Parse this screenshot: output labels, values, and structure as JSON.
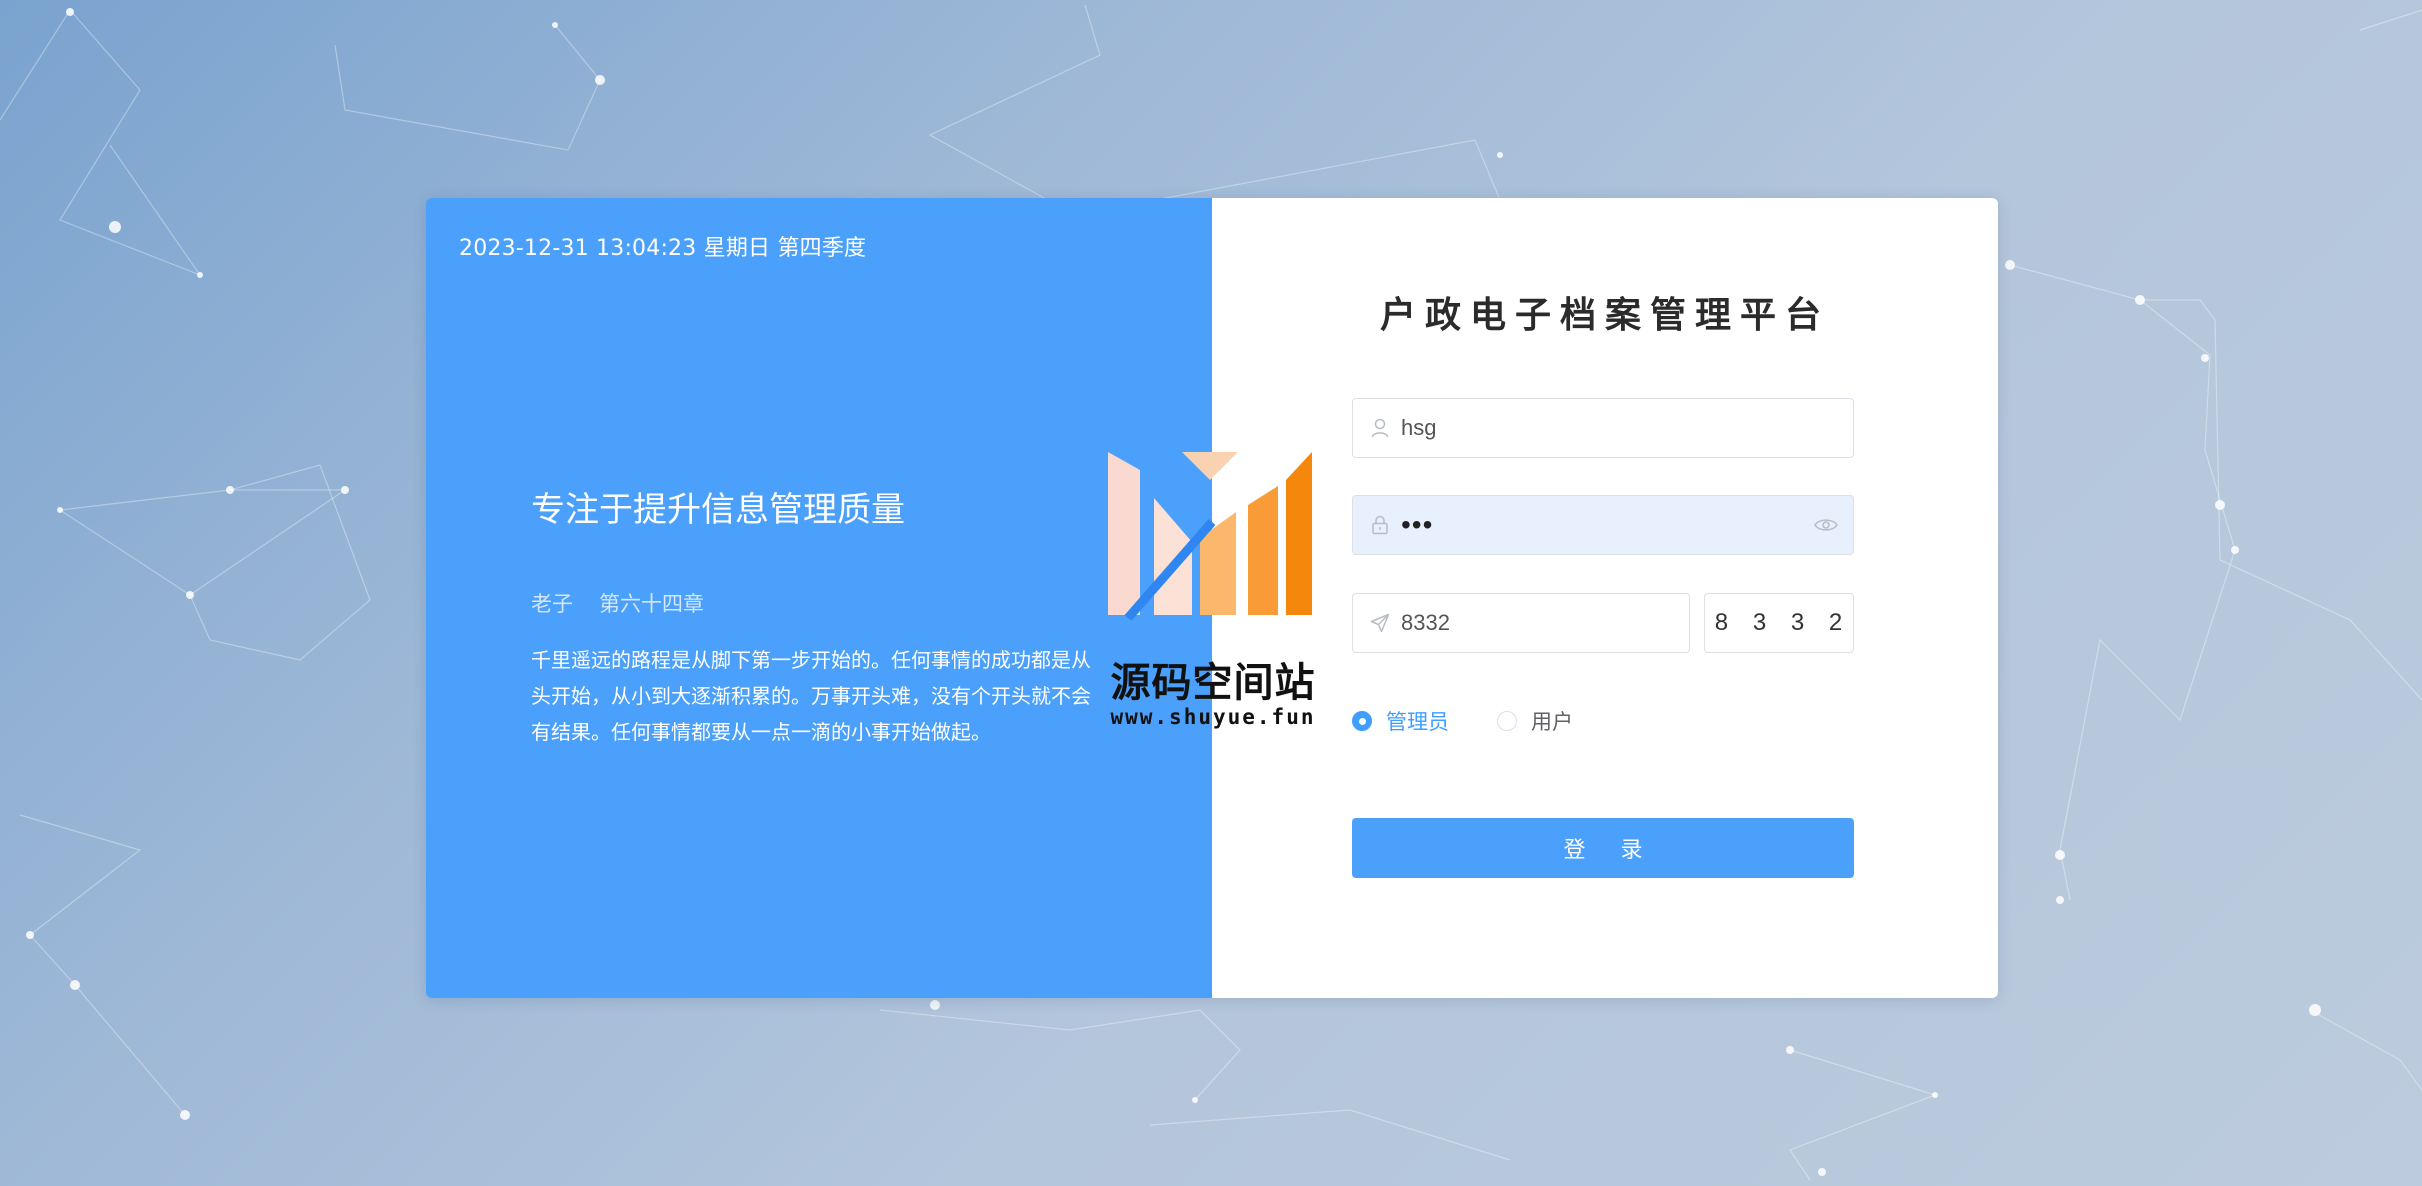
{
  "left_panel": {
    "datetime": "2023-12-31 13:04:23 星期日 第四季度",
    "motto": "专注于提升信息管理质量",
    "author": "老子",
    "chapter": "第六十四章",
    "quote": "千里遥远的路程是从脚下第一步开始的。任何事情的成功都是从头开始，从小到大逐渐积累的。万事开头难，没有个开头就不会有结果。任何事情都要从一点一滴的小事开始做起。"
  },
  "login_form": {
    "title": "户政电子档案管理平台",
    "username": {
      "value": "hsg",
      "icon": "user-icon"
    },
    "password": {
      "value": "•••",
      "icon": "lock-icon",
      "toggle_icon": "eye-icon"
    },
    "captcha": {
      "value": "8332",
      "icon": "send-icon",
      "image_text": "8 3 3 2"
    },
    "roles": [
      {
        "label": "管理员",
        "selected": true
      },
      {
        "label": "用户",
        "selected": false
      }
    ],
    "submit_label": "登 录"
  },
  "watermark": {
    "name": "源码空间站",
    "url": "www.shuyue.fun"
  },
  "colors": {
    "primary": "#4ba0fb",
    "radio_active": "#409eff",
    "background_start": "#7aa3cf",
    "background_end": "#bccbdd"
  }
}
